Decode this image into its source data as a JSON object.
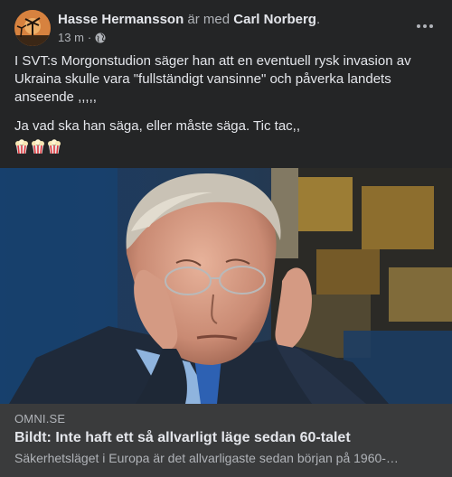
{
  "post": {
    "author": "Hasse Hermansson",
    "with_text": "är med",
    "tagged": "Carl Norberg",
    "tagged_suffix": ".",
    "time": "13 m",
    "dot": "·",
    "audience_icon": "globe-icon",
    "paragraphs": [
      "I SVT:s Morgonstudion säger han att en eventuell rysk invasion av Ukraina skulle vara \"fullständigt vansinne\" och påverka landets anseende ,,,,,",
      "Ja vad ska han säga, eller måste säga. Tic tac,,"
    ],
    "emojis": [
      "popcorn",
      "popcorn",
      "popcorn"
    ]
  },
  "link": {
    "domain": "OMNI.SE",
    "headline": "Bildt: Inte haft ett så allvarligt läge sedan 60-talet",
    "description": "Säkerhetsläget i Europa är det allvarligaste sedan början på 1960-…"
  },
  "colors": {
    "card_bg": "#242526",
    "link_bg": "#3a3b3c",
    "primary_text": "#e4e6eb",
    "secondary_text": "#b0b3b8"
  }
}
